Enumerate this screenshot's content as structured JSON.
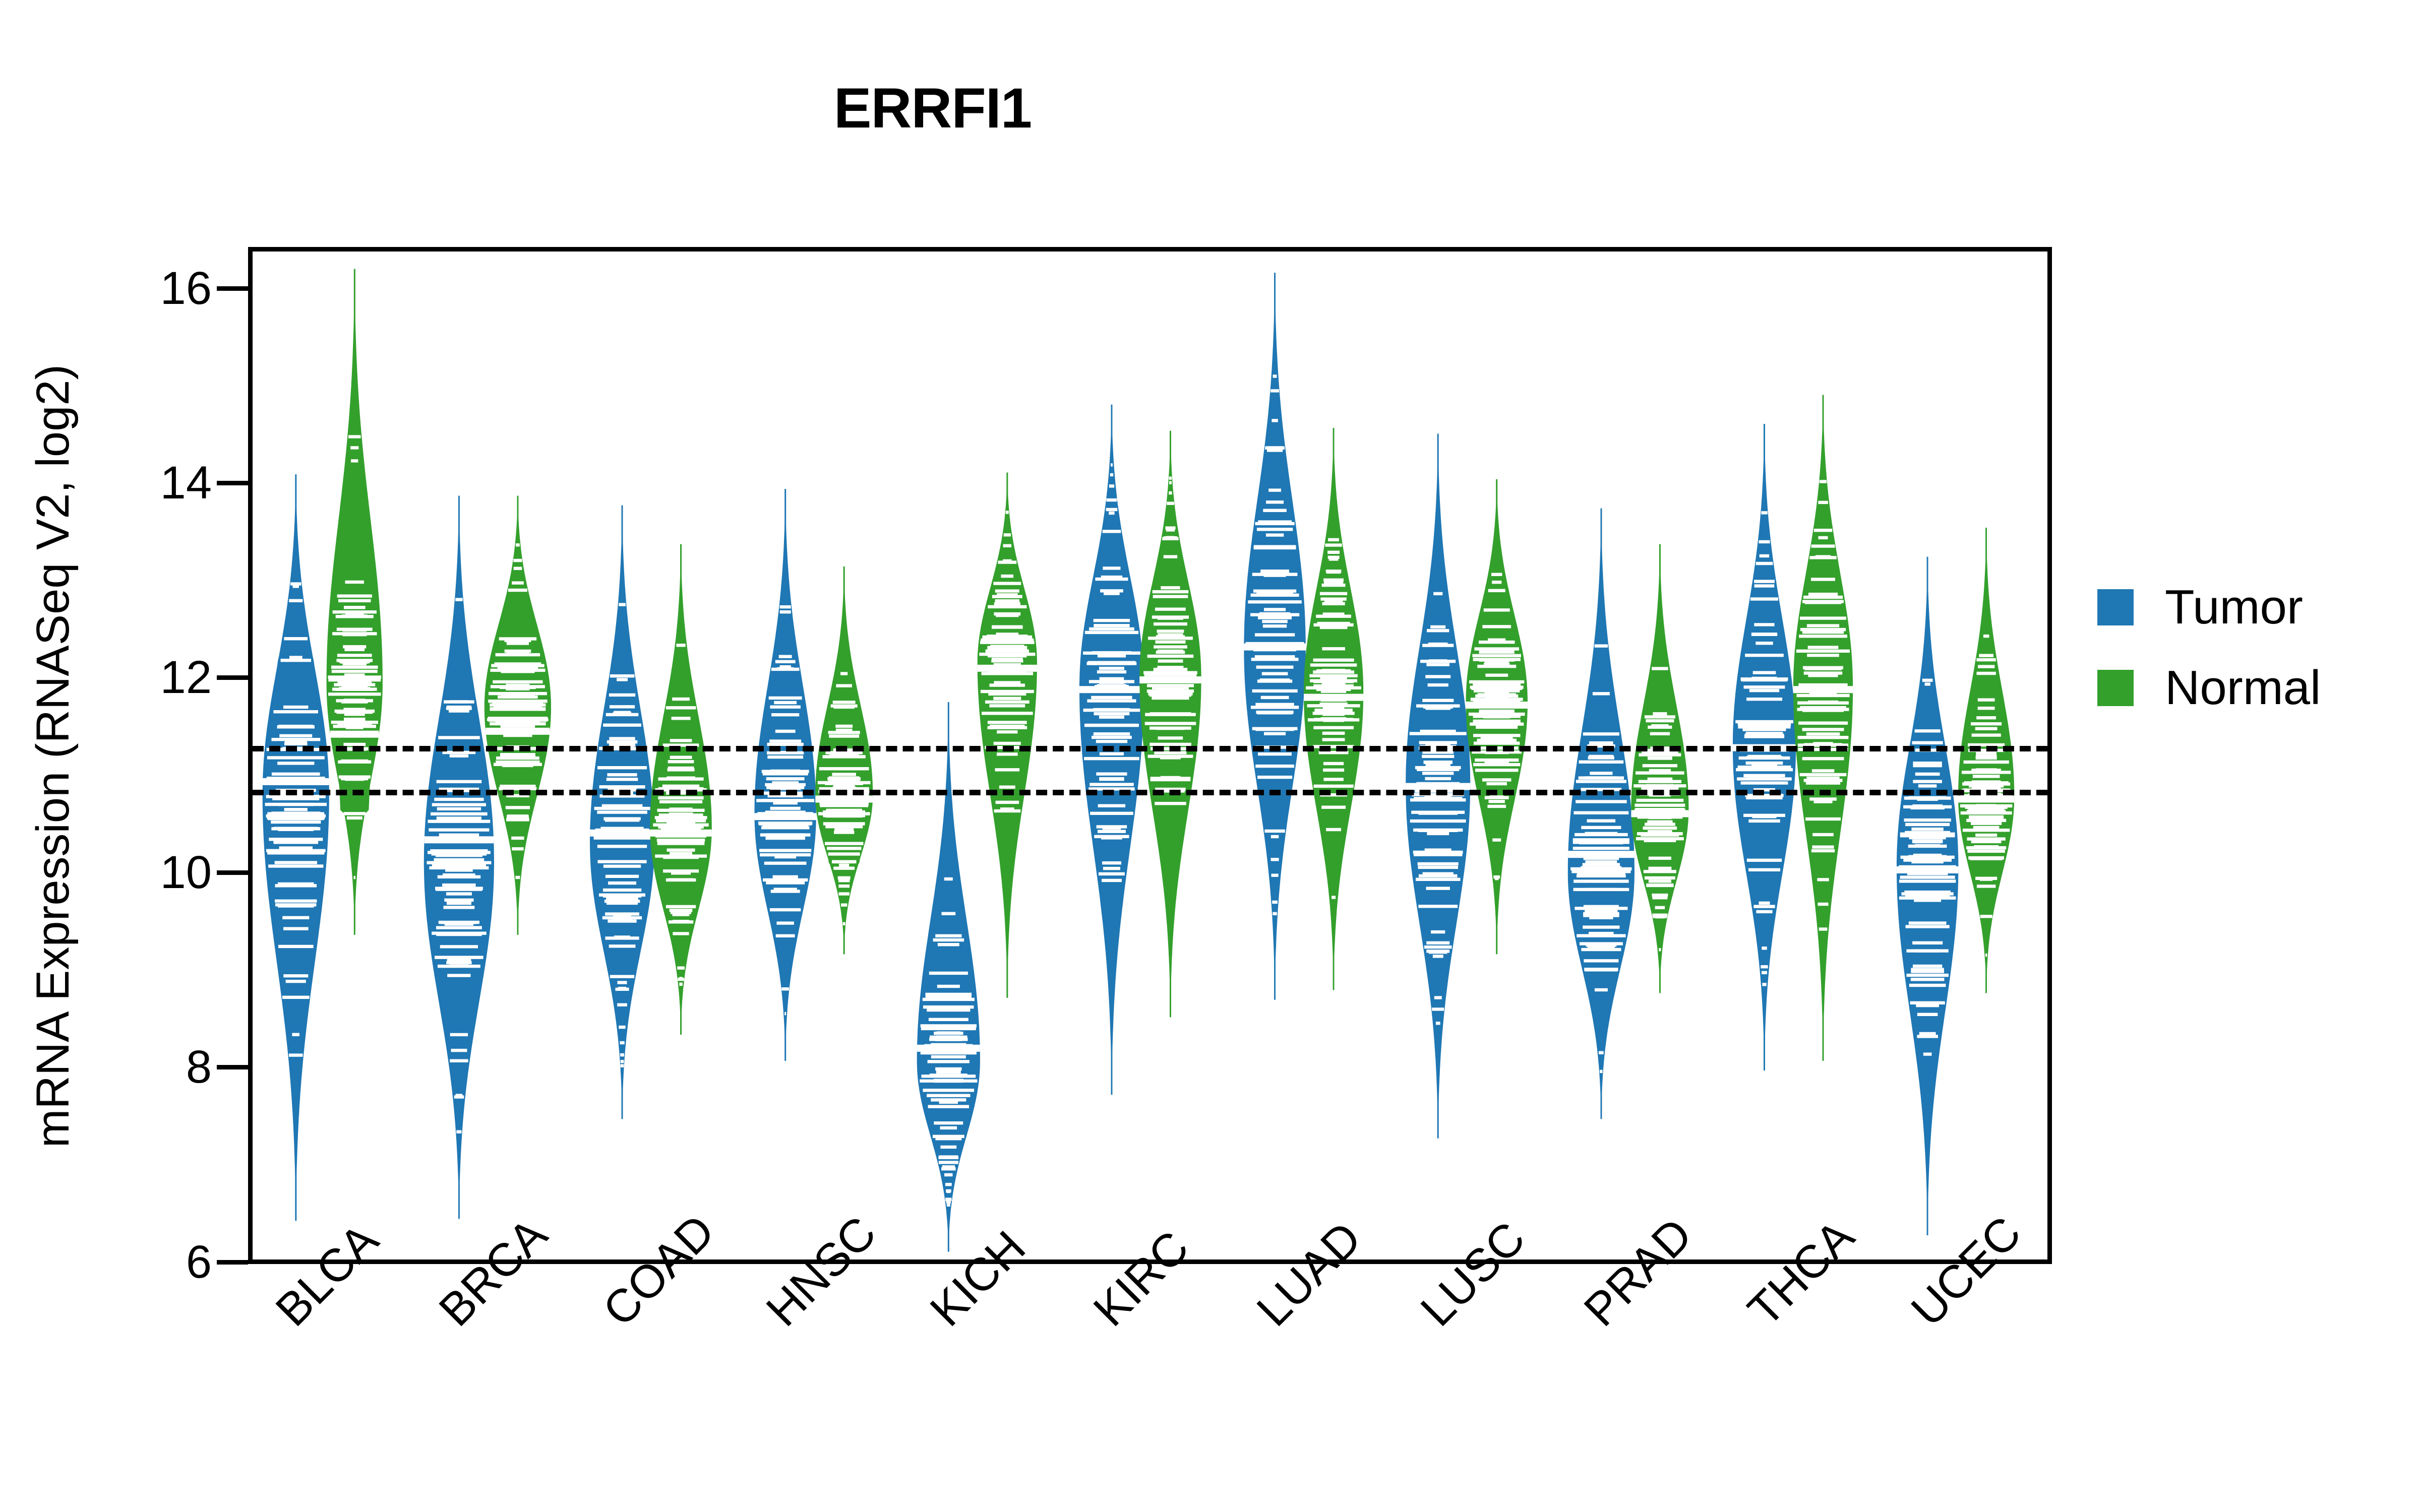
{
  "chart": {
    "title": "ERRFI1",
    "ylabel": "mRNA Expression (RNASeq V2, log2)"
  },
  "legend": {
    "items": [
      {
        "label": "Tumor",
        "color": "#1F77B4"
      },
      {
        "label": "Normal",
        "color": "#33A02C"
      }
    ]
  },
  "chart_data": {
    "type": "violin",
    "title": "ERRFI1",
    "xlabel": "",
    "ylabel": "mRNA Expression (RNASeq V2, log2)",
    "ylim": [
      6,
      16.4
    ],
    "yticks": [
      6,
      8,
      10,
      12,
      14,
      16
    ],
    "ytick_labels": [
      "6",
      "8",
      "10",
      "12",
      "14",
      "16"
    ],
    "grid": false,
    "legend_position": "right",
    "reference_lines": [
      {
        "value": 11.32,
        "style": "dashed",
        "color": "#000000"
      },
      {
        "value": 10.87,
        "style": "dashed",
        "color": "#000000"
      }
    ],
    "categories": [
      "BLCA",
      "BRCA",
      "COAD",
      "HNSC",
      "KICH",
      "KIRC",
      "LUAD",
      "LUSC",
      "PRAD",
      "THCA",
      "UCEC"
    ],
    "series": [
      {
        "name": "Tumor",
        "color": "#1F77B4",
        "violins": [
          {
            "category": "BLCA",
            "median": 10.93,
            "q1": 9.85,
            "q3": 12.18,
            "min": 6.4,
            "max": 14.1,
            "peak": 10.8,
            "width": 0.95
          },
          {
            "category": "BRCA",
            "median": 10.33,
            "q1": 9.55,
            "q3": 11.25,
            "min": 6.42,
            "max": 13.88,
            "peak": 10.1,
            "width": 1.0
          },
          {
            "category": "COAD",
            "median": 10.4,
            "q1": 9.55,
            "q3": 11.35,
            "min": 7.45,
            "max": 13.78,
            "peak": 10.3,
            "width": 0.92
          },
          {
            "category": "HNSC",
            "median": 10.57,
            "q1": 9.95,
            "q3": 11.5,
            "min": 8.05,
            "max": 13.95,
            "peak": 10.6,
            "width": 0.88
          },
          {
            "category": "KICH",
            "median": 8.18,
            "q1": 7.55,
            "q3": 8.75,
            "min": 6.08,
            "max": 11.75,
            "peak": 8.05,
            "width": 0.9
          },
          {
            "category": "KIRC",
            "median": 11.88,
            "q1": 10.8,
            "q3": 12.7,
            "min": 7.7,
            "max": 14.82,
            "peak": 11.9,
            "width": 0.92
          },
          {
            "category": "LUAD",
            "median": 12.32,
            "q1": 11.3,
            "q3": 13.15,
            "min": 8.68,
            "max": 16.18,
            "peak": 12.3,
            "width": 0.88
          },
          {
            "category": "LUSC",
            "median": 10.88,
            "q1": 10.2,
            "q3": 11.85,
            "min": 7.25,
            "max": 14.52,
            "peak": 10.9,
            "width": 0.92
          },
          {
            "category": "PRAD",
            "median": 10.18,
            "q1": 9.55,
            "q3": 10.85,
            "min": 7.45,
            "max": 13.75,
            "peak": 10.0,
            "width": 0.95
          },
          {
            "category": "THCA",
            "median": 11.28,
            "q1": 10.55,
            "q3": 11.95,
            "min": 7.95,
            "max": 14.62,
            "peak": 11.3,
            "width": 0.9
          },
          {
            "category": "UCEC",
            "median": 10.02,
            "q1": 9.3,
            "q3": 10.92,
            "min": 6.25,
            "max": 13.25,
            "peak": 10.05,
            "width": 0.88
          }
        ]
      },
      {
        "name": "Normal",
        "color": "#33A02C",
        "violins": [
          {
            "category": "BLCA",
            "median": 11.42,
            "q1": 10.6,
            "q3": 12.12,
            "min": 9.35,
            "max": 16.22,
            "peak": 11.95,
            "width": 0.8
          },
          {
            "category": "BRCA",
            "median": 11.45,
            "q1": 10.85,
            "q3": 12.1,
            "min": 9.35,
            "max": 13.88,
            "peak": 11.7,
            "width": 0.95
          },
          {
            "category": "COAD",
            "median": 10.4,
            "q1": 9.85,
            "q3": 11.25,
            "min": 8.32,
            "max": 13.38,
            "peak": 10.45,
            "width": 0.88
          },
          {
            "category": "HNSC",
            "median": 10.75,
            "q1": 10.1,
            "q3": 11.35,
            "min": 9.15,
            "max": 13.15,
            "peak": 10.8,
            "width": 0.82
          },
          {
            "category": "KICH",
            "median": 12.1,
            "q1": 11.35,
            "q3": 12.72,
            "min": 8.7,
            "max": 14.12,
            "peak": 12.15,
            "width": 0.85
          },
          {
            "category": "KIRC",
            "median": 11.98,
            "q1": 11.2,
            "q3": 12.72,
            "min": 8.5,
            "max": 14.55,
            "peak": 12.0,
            "width": 0.88
          },
          {
            "category": "LUAD",
            "median": 11.8,
            "q1": 11.05,
            "q3": 12.45,
            "min": 8.78,
            "max": 14.58,
            "peak": 11.85,
            "width": 0.85
          },
          {
            "category": "LUSC",
            "median": 11.72,
            "q1": 10.95,
            "q3": 12.35,
            "min": 9.15,
            "max": 14.05,
            "peak": 11.75,
            "width": 0.88
          },
          {
            "category": "PRAD",
            "median": 10.6,
            "q1": 10.05,
            "q3": 11.25,
            "min": 8.75,
            "max": 13.38,
            "peak": 10.65,
            "width": 0.82
          },
          {
            "category": "THCA",
            "median": 11.88,
            "q1": 11.2,
            "q3": 12.6,
            "min": 8.05,
            "max": 14.92,
            "peak": 11.9,
            "width": 0.85
          },
          {
            "category": "UCEC",
            "median": 10.75,
            "q1": 10.25,
            "q3": 11.25,
            "min": 8.75,
            "max": 13.55,
            "peak": 10.78,
            "width": 0.8
          }
        ]
      }
    ]
  }
}
